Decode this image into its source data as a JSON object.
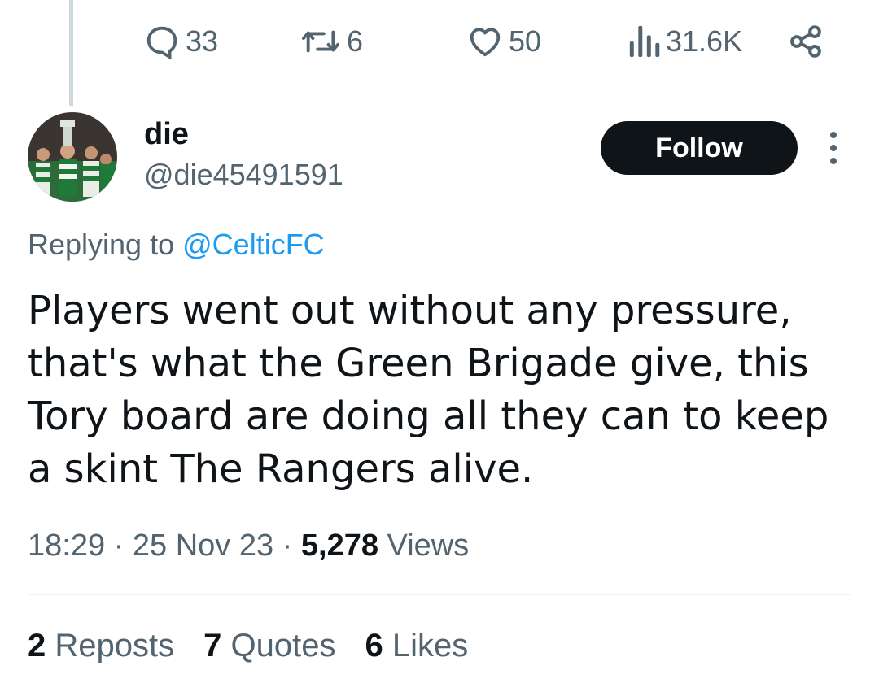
{
  "action_bar": {
    "replies": "33",
    "reposts": "6",
    "likes": "50",
    "views": "31.6K"
  },
  "icons": {
    "reply": "comment-bubble-icon",
    "repost": "repost-arrows-icon",
    "like": "heart-icon",
    "views": "bar-chart-icon",
    "share": "share-icon",
    "more": "more-vertical-icon"
  },
  "author": {
    "display_name": "die",
    "handle": "@die45491591",
    "follow_label": "Follow"
  },
  "reply_context": {
    "prefix": "Replying to",
    "mention": "@CelticFC"
  },
  "tweet": {
    "text": "Players went out without any pressure, that's what the Green Brigade give, this Tory board are doing all they can to keep a skint The Rangers alive."
  },
  "meta": {
    "time": "18:29",
    "separator": "·",
    "date": "25 Nov 23",
    "views_count": "5,278",
    "views_label": "Views"
  },
  "engagement": {
    "reposts_count": "2",
    "reposts_label": "Reposts",
    "quotes_count": "7",
    "quotes_label": "Quotes",
    "likes_count": "6",
    "likes_label": "Likes"
  },
  "colors": {
    "text": "#0f1419",
    "secondary": "#536471",
    "link": "#1d9bf0",
    "button": "#0f1419"
  }
}
